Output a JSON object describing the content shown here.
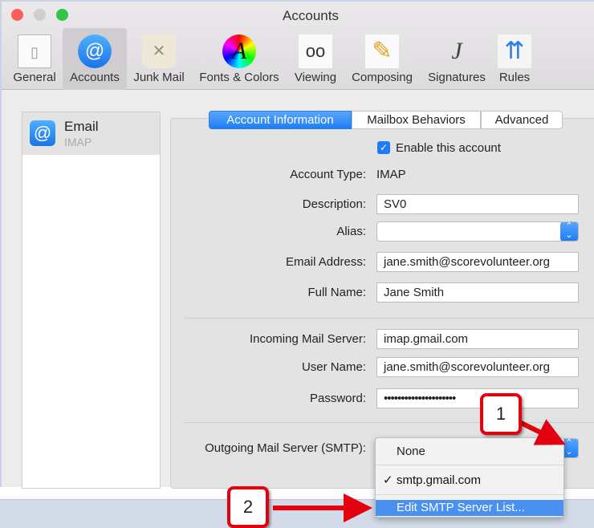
{
  "window": {
    "title": "Accounts"
  },
  "toolbar": [
    {
      "label": "General",
      "icon": "switch-icon"
    },
    {
      "label": "Accounts",
      "icon": "at-icon",
      "selected": true
    },
    {
      "label": "Junk Mail",
      "icon": "trash-icon"
    },
    {
      "label": "Fonts & Colors",
      "icon": "font-color-icon"
    },
    {
      "label": "Viewing",
      "icon": "glasses-icon"
    },
    {
      "label": "Composing",
      "icon": "pencil-icon"
    },
    {
      "label": "Signatures",
      "icon": "signature-icon"
    },
    {
      "label": "Rules",
      "icon": "rules-icon"
    }
  ],
  "sidebar": {
    "account": {
      "name": "Email",
      "type": "IMAP"
    }
  },
  "tabs": [
    "Account Information",
    "Mailbox Behaviors",
    "Advanced"
  ],
  "form": {
    "enable_label": "Enable this account",
    "enabled": true,
    "account_type_label": "Account Type:",
    "account_type": "IMAP",
    "description_label": "Description:",
    "description": "SV0",
    "alias_label": "Alias:",
    "alias": "",
    "email_label": "Email Address:",
    "email": "jane.smith@scorevolunteer.org",
    "fullname_label": "Full Name:",
    "fullname": "Jane Smith",
    "incoming_label": "Incoming Mail Server:",
    "incoming": "imap.gmail.com",
    "username_label": "User Name:",
    "username": "jane.smith@scorevolunteer.org",
    "password_label": "Password:",
    "password": "•••••••••••••••••••••",
    "outgoing_label": "Outgoing Mail Server (SMTP):"
  },
  "smtp_menu": {
    "items": [
      "None",
      "smtp.gmail.com",
      "Edit SMTP Server List..."
    ],
    "checkmark": "✓"
  },
  "callouts": [
    "1",
    "2"
  ],
  "colors": {
    "accent": "#1e7df4",
    "callout": "#e3000f"
  }
}
